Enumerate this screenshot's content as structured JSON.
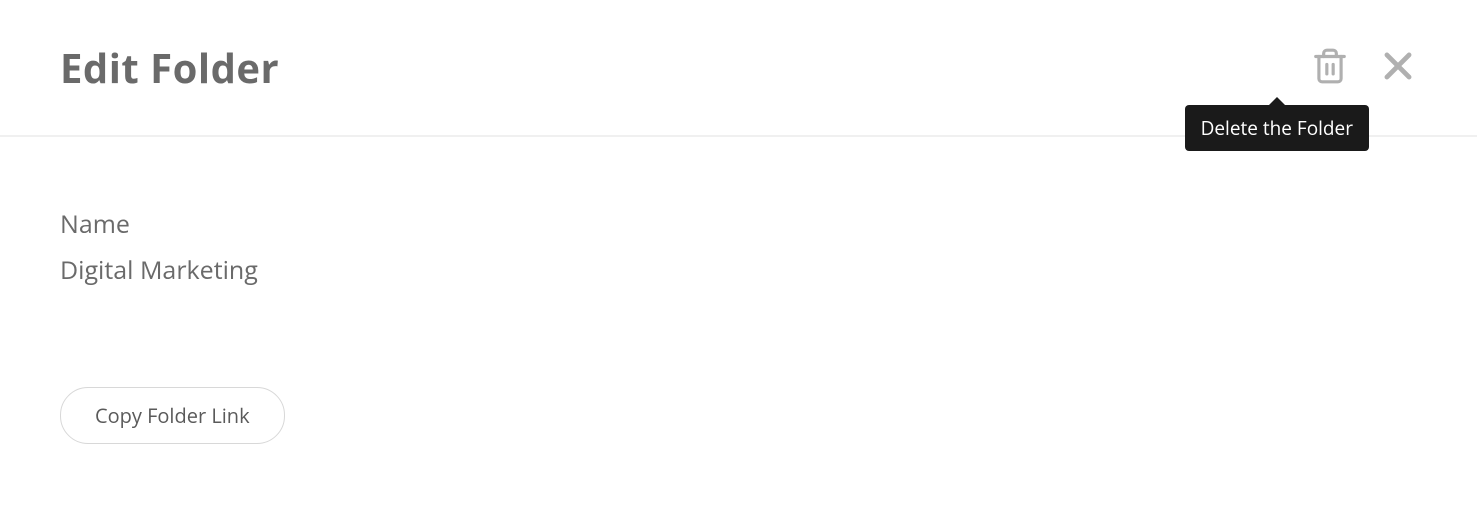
{
  "header": {
    "title": "Edit Folder",
    "delete_tooltip": "Delete the Folder"
  },
  "form": {
    "name_label": "Name",
    "name_value": "Digital Marketing",
    "copy_button_label": "Copy Folder Link"
  }
}
